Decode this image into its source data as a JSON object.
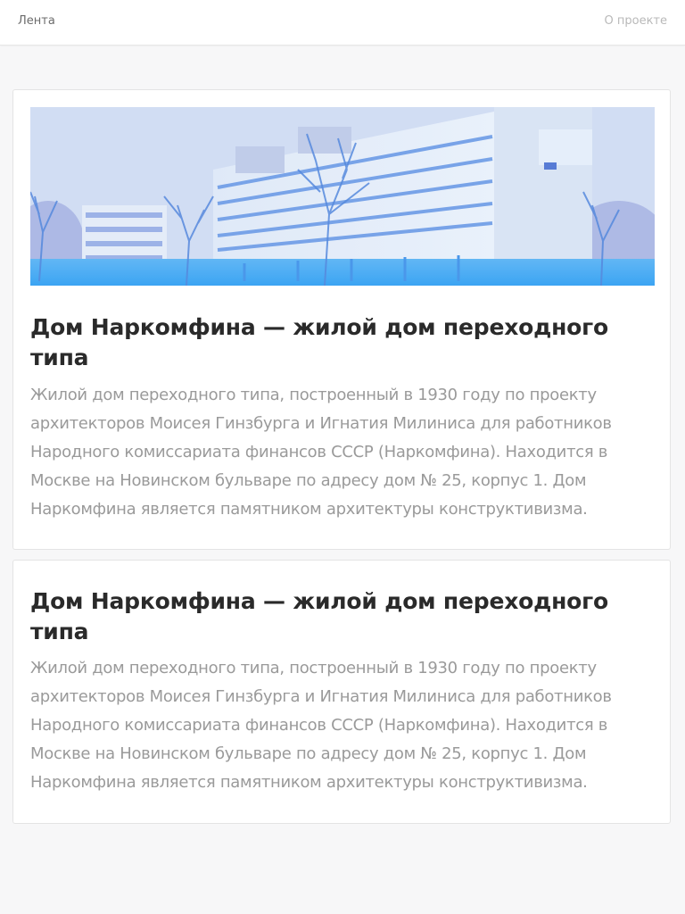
{
  "nav": {
    "feed_label": "Лента",
    "about_label": "О проекте"
  },
  "colors": {
    "page_background": "#f7f7f8",
    "title": "#2a2a2a",
    "text": "#9a9a9a",
    "image_tint": "#3aa0f0"
  },
  "posts": [
    {
      "has_image": true,
      "image_icon": "building-photo",
      "title": "Дом Наркомфина — жилой дом переходного типа",
      "text": "Жилой дом переходного типа, построенный в 1930 году по проекту архитекторов Моисея Гинзбурга и Игнатия Милиниса для работников Народного комиссариата финансов СССР (Наркомфина). Находится в Москве на Новинском бульваре по адресу дом № 25, корпус 1. Дом Наркомфина является памятником архитектуры конструктивизма."
    },
    {
      "has_image": false,
      "title": "Дом Наркомфина — жилой дом переходного типа",
      "text": "Жилой дом переходного типа, построенный в 1930 году по проекту архитекторов Моисея Гинзбурга и Игнатия Милиниса для работников Народного комиссариата финансов СССР (Наркомфина). Находится в Москве на Новинском бульваре по адресу дом № 25, корпус 1. Дом Наркомфина является памятником архитектуры конструктивизма."
    }
  ]
}
